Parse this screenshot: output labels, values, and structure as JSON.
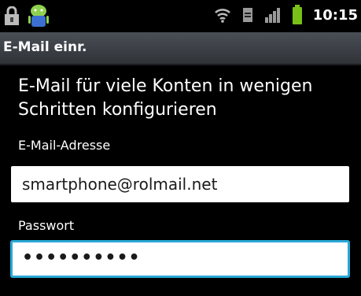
{
  "status_bar": {
    "time": "10:15",
    "icons": [
      "lock-icon",
      "android-icon",
      "wifi-icon",
      "sim-icon",
      "signal-icon",
      "battery-icon"
    ],
    "battery_color": "#78c018"
  },
  "title_bar": {
    "title": "E-Mail einr."
  },
  "main": {
    "heading": "E-Mail für viele Konten in wenigen Schritten konfigurieren",
    "email": {
      "label": "E-Mail-Adresse",
      "value": "smartphone@rolmail.net"
    },
    "password": {
      "label": "Passwort",
      "value": "••••••••••"
    }
  },
  "colors": {
    "focus": "#2aa9d8",
    "titlebar": "#3a3e44"
  }
}
